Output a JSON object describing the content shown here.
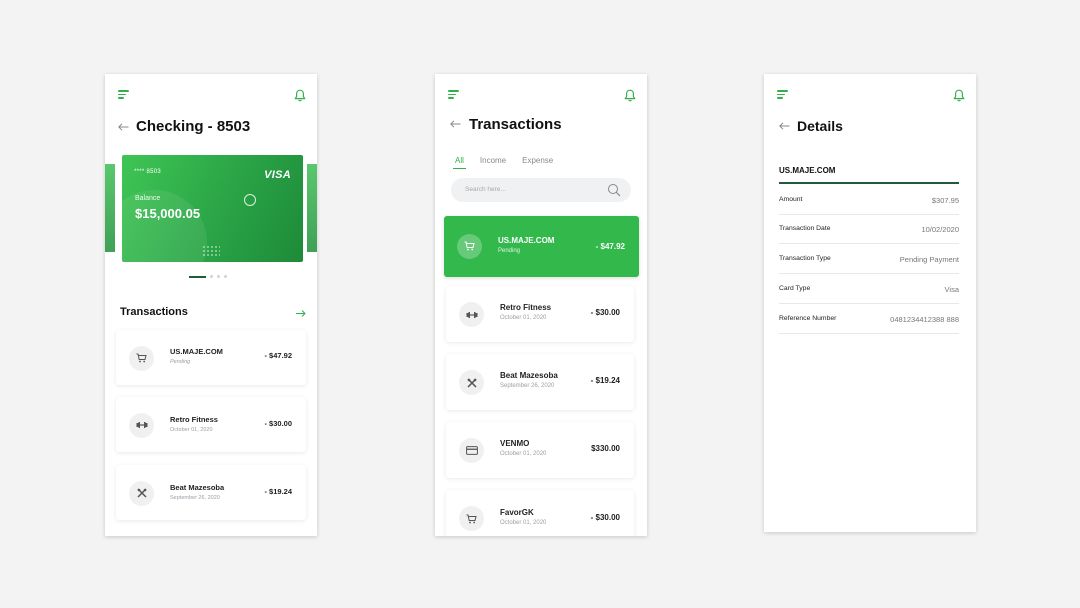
{
  "colors": {
    "accent": "#33b04a",
    "dark_green": "#1f5c39",
    "background": "#f3f3f3"
  },
  "screen1": {
    "title": "Checking - 8503",
    "card": {
      "number": "**** 8503",
      "brand": "VISA",
      "balance_label": "Balance",
      "balance": "$15,000.05"
    },
    "carousel": {
      "pages": 4,
      "active_index": 0
    },
    "section_title": "Transactions",
    "transactions": [
      {
        "icon": "cart-icon",
        "name": "US.MAJE.COM",
        "sub": "Pending",
        "amount": "- $47.92"
      },
      {
        "icon": "dumbbell-icon",
        "name": "Retro Fitness",
        "sub": "October 01, 2020",
        "amount": "- $30.00"
      },
      {
        "icon": "utensils-icon",
        "name": "Beat Mazesoba",
        "sub": "September 26, 2020",
        "amount": "- $19.24"
      }
    ]
  },
  "screen2": {
    "title": "Transactions",
    "tabs": [
      "All",
      "Income",
      "Expense"
    ],
    "active_tab": "All",
    "search_placeholder": "Search here...",
    "transactions": [
      {
        "icon": "cart-icon",
        "name": "US.MAJE.COM",
        "sub": "Pending",
        "amount": "- $47.92",
        "highlighted": true
      },
      {
        "icon": "dumbbell-icon",
        "name": "Retro Fitness",
        "sub": "October 01, 2020",
        "amount": "- $30.00"
      },
      {
        "icon": "utensils-icon",
        "name": "Beat Mazesoba",
        "sub": "September 26, 2020",
        "amount": "- $19.24"
      },
      {
        "icon": "card-icon",
        "name": "VENMO",
        "sub": "October 01, 2020",
        "amount": "$330.00"
      },
      {
        "icon": "cart-icon",
        "name": "FavorGK",
        "sub": "October 01, 2020",
        "amount": "- $30.00"
      }
    ]
  },
  "screen3": {
    "title": "Details",
    "merchant": "US.MAJE.COM",
    "rows": [
      {
        "label": "Amount",
        "value": "$307.95"
      },
      {
        "label": "Transaction Date",
        "value": "10/02/2020"
      },
      {
        "label": "Transaction Type",
        "value": "Pending Payment"
      },
      {
        "label": "Card Type",
        "value": "Visa"
      },
      {
        "label": "Reference Number",
        "value": "0481234412388 888"
      }
    ]
  }
}
